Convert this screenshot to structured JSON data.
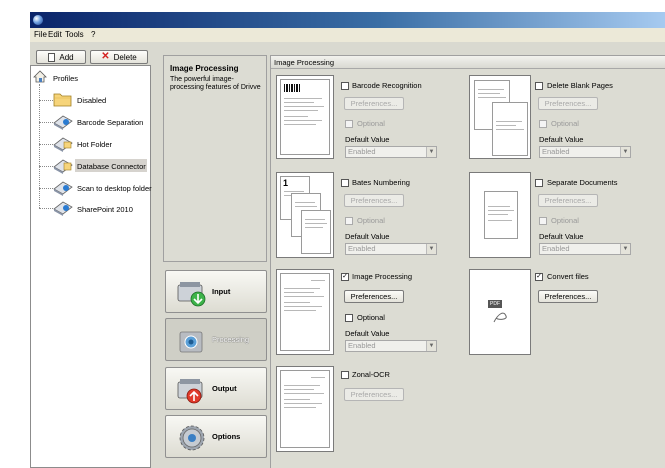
{
  "menu": {
    "file": "File",
    "edit": "Edit",
    "tools": "Tools",
    "help": "?"
  },
  "toolbar": {
    "add_label": "Add",
    "delete_label": "Delete"
  },
  "tree": {
    "root": "Profiles",
    "items": [
      {
        "label": "Disabled"
      },
      {
        "label": "Barcode Separation"
      },
      {
        "label": "Hot Folder"
      },
      {
        "label": "Database Connector",
        "selected": true
      },
      {
        "label": "Scan to desktop folder"
      },
      {
        "label": "SharePoint 2010"
      }
    ]
  },
  "info": {
    "title": "Image Processing",
    "description": "The powerful image-processing features of Drivve"
  },
  "categories": [
    {
      "label": "Input"
    },
    {
      "label": "Processing",
      "active": true
    },
    {
      "label": "Output"
    },
    {
      "label": "Options"
    }
  ],
  "content": {
    "header": "Image Processing",
    "modules": [
      {
        "name": "Barcode Recognition",
        "checked": false,
        "preferences": "Preferences...",
        "optional": "Optional",
        "default_label": "Default Value",
        "default_value": "Enabled"
      },
      {
        "name": "Delete Blank Pages",
        "checked": false,
        "preferences": "Preferences...",
        "optional": "Optional",
        "default_label": "Default Value",
        "default_value": "Enabled"
      },
      {
        "name": "Bates Numbering",
        "checked": false,
        "preferences": "Preferences...",
        "optional": "Optional",
        "default_label": "Default Value",
        "default_value": "Enabled"
      },
      {
        "name": "Separate Documents",
        "checked": false,
        "preferences": "Preferences...",
        "optional": "Optional",
        "default_label": "Default Value",
        "default_value": "Enabled"
      },
      {
        "name": "Image Processing",
        "checked": true,
        "preferences": "Preferences...",
        "optional": "Optional",
        "default_label": "Default Value",
        "default_value": "Enabled"
      },
      {
        "name": "Convert files",
        "checked": true,
        "preferences": "Preferences..."
      },
      {
        "name": "Zonal-OCR",
        "checked": false,
        "preferences": "Preferences..."
      }
    ],
    "thumb_number": "1",
    "pdf_badge": "PDF"
  },
  "colors": {
    "titlebar_start": "#0a246a",
    "titlebar_end": "#a6caf0",
    "delete_x": "#d42020"
  }
}
